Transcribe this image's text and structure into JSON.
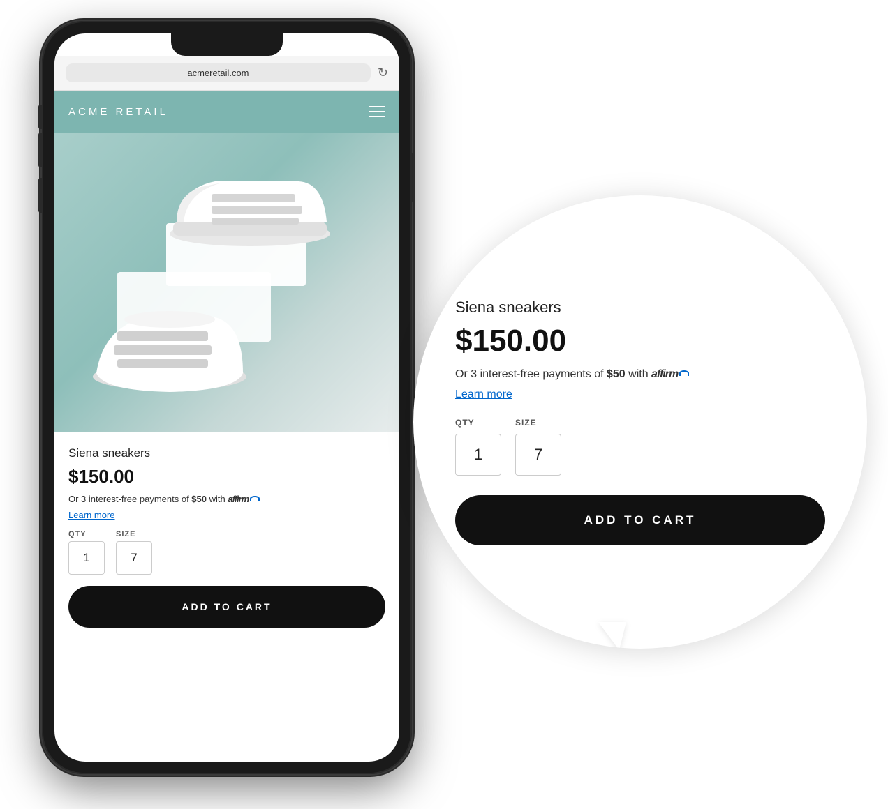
{
  "phone": {
    "browser": {
      "url": "acmeretail.com",
      "refresh_icon": "↻"
    },
    "store": {
      "logo": "ACME RETAIL"
    },
    "product": {
      "name": "Siena sneakers",
      "price": "$150.00",
      "affirm_text_prefix": "Or 3 interest-free payments of ",
      "affirm_amount": "$50",
      "affirm_text_suffix": " with ",
      "affirm_brand": "affirm",
      "learn_more": "Learn more",
      "qty_label": "QTY",
      "size_label": "SIZE",
      "qty_value": "1",
      "size_value": "7",
      "add_to_cart": "ADD TO CART"
    }
  },
  "bubble": {
    "product": {
      "name": "Siena sneakers",
      "price": "$150.00",
      "affirm_text_prefix": "Or 3 interest-free payments of ",
      "affirm_amount": "$50",
      "affirm_text_suffix": " with ",
      "affirm_brand": "affirm",
      "learn_more": "Learn more",
      "qty_label": "QTY",
      "size_label": "SIZE",
      "qty_value": "1",
      "size_value": "7",
      "add_to_cart": "ADD TO CART"
    }
  }
}
